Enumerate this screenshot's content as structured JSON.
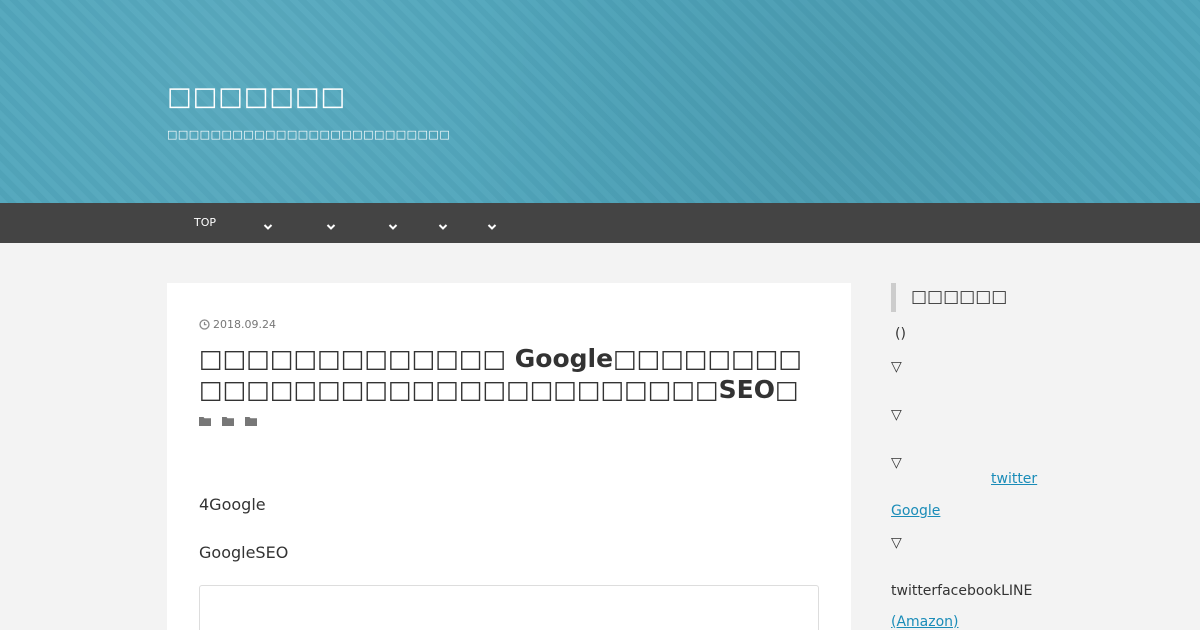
{
  "header": {
    "site_title": "□□□□□□□",
    "site_description": "□□□□□□□□□□□□□□□□□□□□□□□□□□"
  },
  "nav": {
    "items": [
      {
        "label": "TOP"
      },
      {
        "label": ""
      },
      {
        "label": ""
      },
      {
        "label": ""
      },
      {
        "label": ""
      },
      {
        "label": ""
      }
    ]
  },
  "article": {
    "date": "2018.09.24",
    "title": "□□□□□□□□□□□□□ Google□□□□□□□□□□□□□□□□□□□□□□□□□□□□□□SEO□",
    "categories": [
      "",
      "",
      ""
    ],
    "paragraphs": [
      "4Google",
      "GoogleSEO"
    ]
  },
  "sidebar": {
    "heading": "□□□□□□",
    "paren": "()",
    "triangle": "▽",
    "twitter_link": "twitter",
    "google_link": "Google",
    "share_text": "twitterfacebookLINE",
    "amazon_link": "(Amazon)"
  },
  "colors": {
    "header_bg": "#4fa5bb",
    "nav_bg": "#444444",
    "link": "#1a8cb8"
  }
}
